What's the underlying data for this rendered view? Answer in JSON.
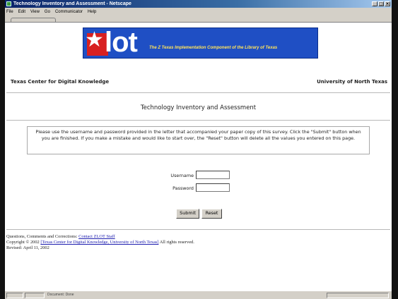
{
  "window": {
    "title": "Technology Inventory and Assessment - Netscape",
    "controls": [
      "_",
      "□",
      "×"
    ]
  },
  "menu": [
    "File",
    "Edit",
    "View",
    "Go",
    "Communicator",
    "Help"
  ],
  "banner": {
    "logo_text": "lot",
    "logo_star": "★",
    "tagline": "The Z Texas Implementation Component of the Library of Texas",
    "colors": {
      "background": "#1f4fc4",
      "z_block": "#d82020",
      "tagline": "#ffe45c"
    }
  },
  "header": {
    "left_org": "Texas Center for Digital Knowledge",
    "right_org": "University of North Texas"
  },
  "page_title": "Technology Inventory and Assessment",
  "instructions": "Please use the username and password provided in the letter that accompanied your paper copy of this survey. Click the \"Submit\" button when you are finished. If you make a mistake and would like to start over, the \"Reset\" button will delete all the values you entered on this page.",
  "form": {
    "username_label": "Username",
    "username_value": "",
    "password_label": "Password",
    "password_value": "",
    "submit_label": "Submit",
    "reset_label": "Reset"
  },
  "footer": {
    "questions_prefix": "Questions, Comments and Corrections:",
    "contact_link": "Contact ZLOT Staff",
    "copyright_prefix": "Copyright © 2002",
    "copyright_link": "[Texas Center for Digital Knowledge, University of North Texas]",
    "rights": "All rights reserved.",
    "revised": "Revised: April 11, 2002"
  },
  "statusbar": {
    "text": "Document: Done"
  }
}
